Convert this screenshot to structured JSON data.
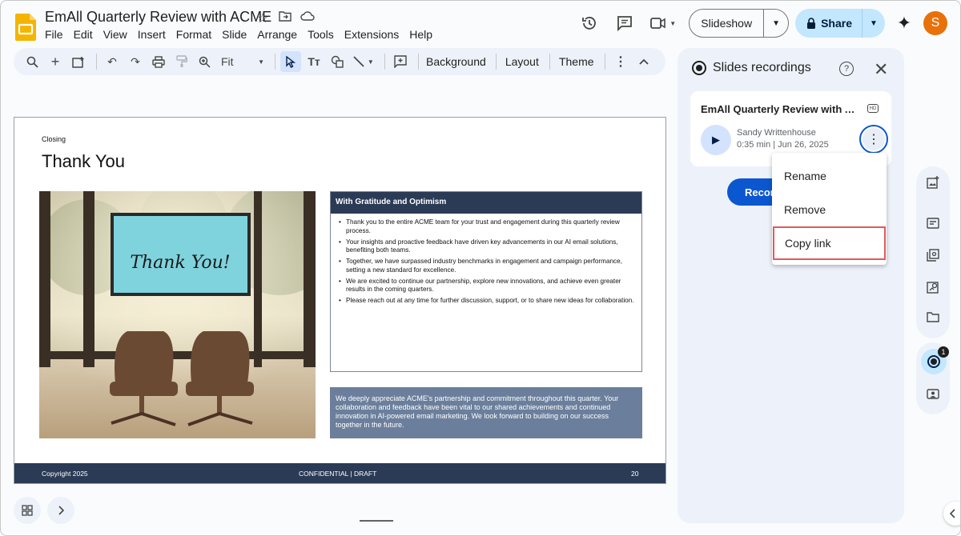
{
  "doc": {
    "title": "EmAll Quarterly Review with ACME"
  },
  "menubar": [
    "File",
    "Edit",
    "View",
    "Insert",
    "Format",
    "Slide",
    "Arrange",
    "Tools",
    "Extensions",
    "Help"
  ],
  "header": {
    "slideshow_label": "Slideshow",
    "share_label": "Share",
    "avatar_letter": "S"
  },
  "toolbar": {
    "zoom_label": "Fit",
    "background_label": "Background",
    "layout_label": "Layout",
    "theme_label": "Theme"
  },
  "slide": {
    "section": "Closing",
    "title": "Thank You",
    "screen_text": "Thank You!",
    "box_heading": "With Gratitude and Optimism",
    "bullets": [
      "Thank you to the entire ACME team for your trust and engagement during this quarterly review process.",
      "Your insights and proactive feedback have driven key advancements in our AI email solutions, benefiting both teams.",
      "Together, we have surpassed industry benchmarks in engagement and campaign performance, setting a new standard for excellence.",
      "We are excited to continue our partnership, explore new innovations, and achieve even greater results in the coming quarters.",
      "Please reach out at any time for further discussion, support, or to share new ideas for collaboration."
    ],
    "note": "We deeply appreciate ACME's partnership and commitment throughout this quarter. Your collaboration and feedback have been vital to our shared achievements and continued innovation in AI-powered email marketing. We look forward to building on our success together in the future.",
    "footer_left": "Copyright 2025",
    "footer_center": "CONFIDENTIAL | DRAFT",
    "footer_page": "20"
  },
  "panel": {
    "title": "Slides recordings",
    "recording": {
      "title": "EmAll Quarterly Review with ACME",
      "hd": "HD",
      "author": "Sandy Writtenhouse",
      "meta": "0:35 min | Jun 26, 2025"
    },
    "record_button": "Record"
  },
  "context_menu": {
    "items": [
      "Rename",
      "Remove",
      "Copy link"
    ],
    "highlighted": "Copy link"
  },
  "rail": {
    "badge_count": "1"
  },
  "colors": {
    "accent": "#0b57d0",
    "share_bg": "#c2e7ff",
    "slide_dark": "#2b3a55",
    "slide_note": "#6b7f9c",
    "highlight": "#e25a5a"
  }
}
